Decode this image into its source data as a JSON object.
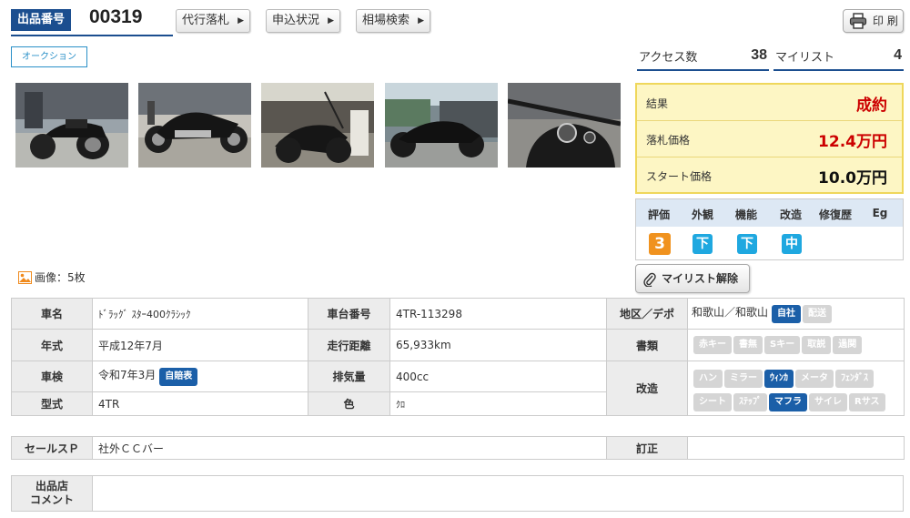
{
  "header": {
    "lot_label": "出品番号",
    "lot_number": "00319",
    "buttons": [
      "代行落札",
      "申込状況",
      "相場検索"
    ],
    "print_label": "印 刷"
  },
  "auction_tag": "オークション",
  "stats": {
    "access_label": "アクセス数",
    "access_value": "38",
    "mylist_label": "マイリスト",
    "mylist_value": "4"
  },
  "photos": [
    {
      "name": "photo-1"
    },
    {
      "name": "photo-2"
    },
    {
      "name": "photo-3"
    },
    {
      "name": "photo-4"
    },
    {
      "name": "photo-5"
    }
  ],
  "image_count": "画像：5枚",
  "result": {
    "result_label": "結果",
    "result_value": "成約",
    "bid_label": "落札価格",
    "bid_value": "12.4万円",
    "start_label": "スタート価格",
    "start_value": "10.0万円"
  },
  "evaluation": {
    "headers": [
      "評価",
      "外観",
      "機能",
      "改造",
      "修復歴",
      "Eg"
    ],
    "score": "3",
    "exterior": "下",
    "function": "下",
    "modification": "中"
  },
  "unmylist_label": "マイリスト解除",
  "spec": {
    "name_label": "車名",
    "name_value": "ﾄﾞﾗｯｸﾞ ｽﾀｰ400ｸﾗｼｯｸ",
    "frame_label": "車台番号",
    "frame_value": "4TR-113298",
    "area_label": "地区／デポ",
    "area_value": "和歌山／和歌山",
    "area_chips": [
      "自社",
      "配送"
    ],
    "year_label": "年式",
    "year_value": "平成12年7月",
    "mileage_label": "走行距離",
    "mileage_value": "65,933km",
    "docs_label": "書類",
    "docs_chips": [
      "赤キー",
      "書無",
      "Sキー",
      "取説",
      "過関"
    ],
    "inspection_label": "車検",
    "inspection_value": "令和7年3月",
    "insurance_chip": "自賠表",
    "displacement_label": "排気量",
    "displacement_value": "400cc",
    "mod_label": "改造",
    "mod_chips_row1": [
      "ハン",
      "ミラー",
      "ｳｨﾝｶ",
      "メータ",
      "ﾌｪﾝﾀﾞｽ"
    ],
    "mod_chips_row2": [
      "シート",
      "ｽﾃｯﾌﾟ",
      "マフラ",
      "サイレ",
      "Rサス"
    ],
    "model_label": "型式",
    "model_value": "4TR",
    "color_label": "色",
    "color_value": "ｸﾛ"
  },
  "sales": {
    "sp_label": "セールスＰ",
    "sp_value": "社外ＣＣバー",
    "correction_label": "訂正",
    "correction_value": ""
  },
  "comment": {
    "label_line1": "出品店",
    "label_line2": "コメント",
    "value": ""
  },
  "colors": {
    "navy": "#1b4e8f",
    "result_red": "#cc0000",
    "score_orange": "#f0921e",
    "grade_cyan": "#1fa8e0",
    "chip_on": "#1b5fa8"
  }
}
